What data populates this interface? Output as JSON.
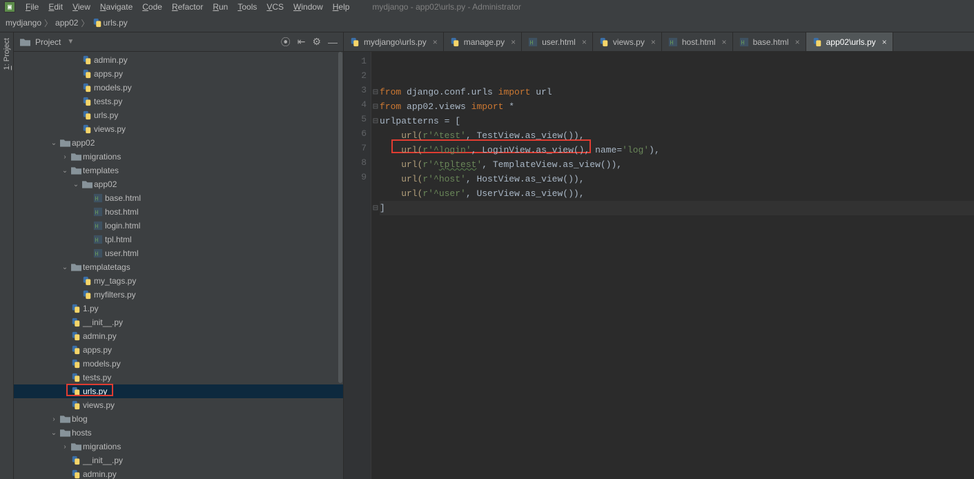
{
  "menu": {
    "items": [
      "File",
      "Edit",
      "View",
      "Navigate",
      "Code",
      "Refactor",
      "Run",
      "Tools",
      "VCS",
      "Window",
      "Help"
    ],
    "title": "mydjango - app02\\urls.py - Administrator"
  },
  "breadcrumb": {
    "crumbs": [
      "mydjango",
      "app02",
      "urls.py"
    ]
  },
  "projectPanel": {
    "title": "Project",
    "icons": {
      "target": "⦿",
      "collapse": "⇤",
      "gear": "⚙",
      "hide": "—"
    }
  },
  "sidebarTool": {
    "label": "1: Project"
  },
  "tree": [
    {
      "depth": 4,
      "chev": "",
      "type": "py",
      "label": "admin.py"
    },
    {
      "depth": 4,
      "chev": "",
      "type": "py",
      "label": "apps.py"
    },
    {
      "depth": 4,
      "chev": "",
      "type": "py",
      "label": "models.py"
    },
    {
      "depth": 4,
      "chev": "",
      "type": "py",
      "label": "tests.py"
    },
    {
      "depth": 4,
      "chev": "",
      "type": "py",
      "label": "urls.py"
    },
    {
      "depth": 4,
      "chev": "",
      "type": "py",
      "label": "views.py"
    },
    {
      "depth": 2,
      "chev": "v",
      "type": "folder",
      "label": "app02"
    },
    {
      "depth": 3,
      "chev": ">",
      "type": "folder",
      "label": "migrations"
    },
    {
      "depth": 3,
      "chev": "v",
      "type": "folder",
      "label": "templates"
    },
    {
      "depth": 4,
      "chev": "v",
      "type": "folder",
      "label": "app02"
    },
    {
      "depth": 5,
      "chev": "",
      "type": "html",
      "label": "base.html"
    },
    {
      "depth": 5,
      "chev": "",
      "type": "html",
      "label": "host.html"
    },
    {
      "depth": 5,
      "chev": "",
      "type": "html",
      "label": "login.html"
    },
    {
      "depth": 5,
      "chev": "",
      "type": "html",
      "label": "tpl.html"
    },
    {
      "depth": 5,
      "chev": "",
      "type": "html",
      "label": "user.html"
    },
    {
      "depth": 3,
      "chev": "v",
      "type": "folder",
      "label": "templatetags"
    },
    {
      "depth": 4,
      "chev": "",
      "type": "py",
      "label": "my_tags.py"
    },
    {
      "depth": 4,
      "chev": "",
      "type": "py",
      "label": "myfilters.py"
    },
    {
      "depth": 3,
      "chev": "",
      "type": "py",
      "label": "1.py"
    },
    {
      "depth": 3,
      "chev": "",
      "type": "py",
      "label": "__init__.py"
    },
    {
      "depth": 3,
      "chev": "",
      "type": "py",
      "label": "admin.py"
    },
    {
      "depth": 3,
      "chev": "",
      "type": "py",
      "label": "apps.py"
    },
    {
      "depth": 3,
      "chev": "",
      "type": "py",
      "label": "models.py"
    },
    {
      "depth": 3,
      "chev": "",
      "type": "py",
      "label": "tests.py"
    },
    {
      "depth": 3,
      "chev": "",
      "type": "py",
      "label": "urls.py",
      "selected": true
    },
    {
      "depth": 3,
      "chev": "",
      "type": "py",
      "label": "views.py"
    },
    {
      "depth": 2,
      "chev": ">",
      "type": "folder",
      "label": "blog"
    },
    {
      "depth": 2,
      "chev": "v",
      "type": "folder",
      "label": "hosts"
    },
    {
      "depth": 3,
      "chev": ">",
      "type": "folder",
      "label": "migrations"
    },
    {
      "depth": 3,
      "chev": "",
      "type": "py",
      "label": "__init__.py"
    },
    {
      "depth": 3,
      "chev": "",
      "type": "py",
      "label": "admin.py"
    }
  ],
  "tabs": [
    {
      "label": "mydjango\\urls.py",
      "type": "py",
      "active": false
    },
    {
      "label": "manage.py",
      "type": "py",
      "active": false
    },
    {
      "label": "user.html",
      "type": "html",
      "active": false
    },
    {
      "label": "views.py",
      "type": "py",
      "active": false
    },
    {
      "label": "host.html",
      "type": "html",
      "active": false
    },
    {
      "label": "base.html",
      "type": "html",
      "active": false
    },
    {
      "label": "app02\\urls.py",
      "type": "py",
      "active": true
    }
  ],
  "editor": {
    "lines": [
      {
        "n": 1,
        "tokens": [
          {
            "t": "from ",
            "c": "kw"
          },
          {
            "t": "django.conf.urls ",
            "c": "fn"
          },
          {
            "t": "import ",
            "c": "kw"
          },
          {
            "t": "url",
            "c": "fn"
          }
        ],
        "fold": "-"
      },
      {
        "n": 2,
        "tokens": [
          {
            "t": "from ",
            "c": "kw"
          },
          {
            "t": "app02.views ",
            "c": "fn"
          },
          {
            "t": "import ",
            "c": "kw"
          },
          {
            "t": "*",
            "c": "fn"
          }
        ],
        "fold": "-"
      },
      {
        "n": 3,
        "tokens": [
          {
            "t": "urlpatterns = ",
            "c": "fn"
          },
          {
            "t": "[",
            "c": "punc"
          }
        ],
        "fold": "-"
      },
      {
        "n": 4,
        "tokens": [
          {
            "t": "    url(",
            "c": "call"
          },
          {
            "t": "r'^test'",
            "c": "str"
          },
          {
            "t": ", ",
            "c": "punc"
          },
          {
            "t": "TestView.as_view()",
            "c": "fn"
          },
          {
            "t": "),",
            "c": "punc"
          }
        ]
      },
      {
        "n": 5,
        "tokens": [
          {
            "t": "    url(",
            "c": "call"
          },
          {
            "t": "r'^login'",
            "c": "str"
          },
          {
            "t": ", ",
            "c": "punc"
          },
          {
            "t": "LoginView.as_view()",
            "c": "fn"
          },
          {
            "t": ", ",
            "c": "punc"
          },
          {
            "t": "name",
            "c": "fn"
          },
          {
            "t": "=",
            "c": "op"
          },
          {
            "t": "'log'",
            "c": "str"
          },
          {
            "t": "),",
            "c": "punc"
          }
        ]
      },
      {
        "n": 6,
        "tokens": [
          {
            "t": "    url(",
            "c": "call"
          },
          {
            "t": "r'^",
            "c": "str"
          },
          {
            "t": "tpltest",
            "c": "str wavy"
          },
          {
            "t": "'",
            "c": "str"
          },
          {
            "t": ", ",
            "c": "punc"
          },
          {
            "t": "TemplateView.as_view()",
            "c": "fn"
          },
          {
            "t": "),",
            "c": "punc"
          }
        ]
      },
      {
        "n": 7,
        "tokens": [
          {
            "t": "    url(",
            "c": "call"
          },
          {
            "t": "r'^host'",
            "c": "str"
          },
          {
            "t": ", ",
            "c": "punc"
          },
          {
            "t": "HostView.as_view()",
            "c": "fn"
          },
          {
            "t": "),",
            "c": "punc"
          }
        ]
      },
      {
        "n": 8,
        "tokens": [
          {
            "t": "    url(",
            "c": "call"
          },
          {
            "t": "r'^user'",
            "c": "str"
          },
          {
            "t": ", ",
            "c": "punc"
          },
          {
            "t": "UserView.as_view()",
            "c": "fn"
          },
          {
            "t": "),",
            "c": "punc"
          }
        ]
      },
      {
        "n": 9,
        "tokens": [
          {
            "t": "]",
            "c": "punc"
          }
        ],
        "fold": "-",
        "current": true
      }
    ]
  }
}
